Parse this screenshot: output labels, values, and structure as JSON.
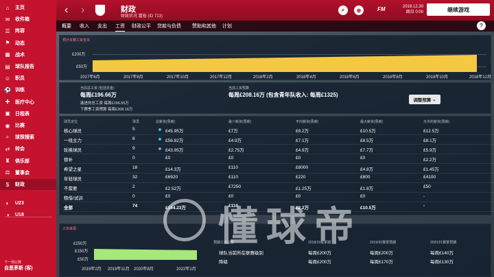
{
  "sidebar": {
    "items": [
      {
        "label": "主页",
        "icon": "home-icon",
        "glyph": "⌂"
      },
      {
        "label": "收件箱",
        "icon": "inbox-icon",
        "glyph": "✉"
      },
      {
        "label": "阵容",
        "icon": "squad-icon",
        "glyph": "☰"
      },
      {
        "label": "动态",
        "icon": "dynamics-icon",
        "glyph": "⚑"
      },
      {
        "label": "战术",
        "icon": "tactics-icon",
        "glyph": "▦"
      },
      {
        "label": "球队报告",
        "icon": "report-icon",
        "glyph": "▤"
      },
      {
        "label": "职员",
        "icon": "staff-icon",
        "glyph": "☺"
      },
      {
        "label": "训练",
        "icon": "training-icon",
        "glyph": "⚽"
      },
      {
        "label": "医疗中心",
        "icon": "medical-icon",
        "glyph": "✚"
      },
      {
        "label": "日程表",
        "icon": "calendar-icon",
        "glyph": "▣"
      },
      {
        "label": "比赛",
        "icon": "match-icon",
        "glyph": "◉"
      },
      {
        "label": "球探搜索",
        "icon": "scouting-icon",
        "glyph": "⌕"
      },
      {
        "label": "转会",
        "icon": "transfers-icon",
        "glyph": "⇄"
      },
      {
        "label": "俱乐部",
        "icon": "club-icon",
        "glyph": "♜"
      },
      {
        "label": "董事会",
        "icon": "board-icon",
        "glyph": "⚖"
      },
      {
        "label": "财政",
        "icon": "finances-icon",
        "glyph": "$"
      },
      {
        "label": "U23",
        "icon": "u23-icon",
        "glyph": "◐"
      },
      {
        "label": "U18",
        "icon": "u18-icon",
        "glyph": "◑"
      }
    ],
    "bottom_hint": "下一场比赛",
    "bottom_name": "自恩茅斯 (客)"
  },
  "header": {
    "title": "财政",
    "subtitle": "财政状况 富裕 (ID 713)",
    "date": "2018.12.30",
    "day": "周日 0:00",
    "continue": "继续游戏",
    "back": "‹",
    "fwd": "›",
    "fm": "FM"
  },
  "tabs": [
    {
      "label": "概要"
    },
    {
      "label": "收入"
    },
    {
      "label": "支出"
    },
    {
      "label": "工资"
    },
    {
      "label": "财政公平"
    },
    {
      "label": "贷款与负债"
    },
    {
      "label": "赞助和其他"
    },
    {
      "label": "计划"
    }
  ],
  "top_chart": {
    "title": "预计本赛工资支出",
    "ylabels": [
      "£200万",
      "£50万"
    ],
    "xlabels": [
      "2017年6月",
      "2017年8月",
      "2017年10月",
      "2017年12月",
      "2018年2月",
      "2018年4月",
      "2018年6月",
      "2018年8月",
      "2018年10月",
      "2018年12月"
    ],
    "bar_color": "#f5c842"
  },
  "summary": {
    "cur_label": "当前总工资 (包括奖金)",
    "cur_value": "每周£196.66万",
    "extra1": "激进的总工资 每周£196.55万",
    "extra2": "下赛季工资预算 每周£208.16万",
    "budget_label": "当前工资预算",
    "budget_value": "每周£208.16万 (包含青年队收入: 每周£1325)",
    "adjust": "调整预算"
  },
  "table": {
    "headers": [
      "球员定位",
      "球员",
      "总薪资(周薪)",
      "最少薪资(周薪)",
      "平均薪资(周薪)",
      "最大薪资(周薪)",
      "允许的薪资(周薪)"
    ],
    "rows": [
      [
        "核心球员",
        "5",
        "£45.95万",
        "£7万",
        "£9.2万",
        "£10.5万",
        "£12.5万"
      ],
      [
        "一线主力",
        "8",
        "£56.82万",
        "£4.9万",
        "£7.1万",
        "£8.5万",
        "£8.1万"
      ],
      [
        "轮换球员",
        "9",
        "£43.95万",
        "£2.75万",
        "£4.9万",
        "£7.7万",
        "£5.9万"
      ],
      [
        "替补",
        "0",
        "£0",
        "£0",
        "£0",
        "£0",
        "£2.2万"
      ],
      [
        "希望之星",
        "18",
        "£14.3万",
        "£110",
        "£8000",
        "£4.8万",
        "£1.45万"
      ],
      [
        "年轻球员",
        "32",
        "£6920",
        "£110",
        "£220",
        "£800",
        "£4100"
      ],
      [
        "不需要",
        "2",
        "£2.52万",
        "£7250",
        "£1.25万",
        "£1.8万",
        "£50"
      ],
      [
        "租借/试训",
        "0",
        "£0",
        "£0",
        "£0",
        "£0",
        "-"
      ],
      [
        "全部",
        "74",
        "£164.23万",
        "£110",
        "£2.2万",
        "£10.5万",
        "-"
      ]
    ]
  },
  "bottom_chart": {
    "title": "工资来源",
    "ylabels": [
      "£250万",
      "£150万",
      "£50万"
    ],
    "xlabels": [
      "2019年2月",
      "2019年11月",
      "2020年8月",
      "2022年1月"
    ],
    "color": "#a6e87a"
  },
  "bottom_info": {
    "c1_head": "预期工资总额",
    "c1_l1": "球队当前所在联赛级别",
    "c1_l2": "降级",
    "c2_head": "2018/19赛季期",
    "c2_v1": "每周£200万",
    "c2_v2": "每周£200万",
    "c3_head": "2019/20赛季预期",
    "c3_v1": "每周£200万",
    "c3_v2": "每周£170万",
    "c4_head": "2020/21赛季预期",
    "c4_v1": "每周£140万",
    "c4_v2": "每周£130万"
  },
  "watermark": "懂球帝"
}
